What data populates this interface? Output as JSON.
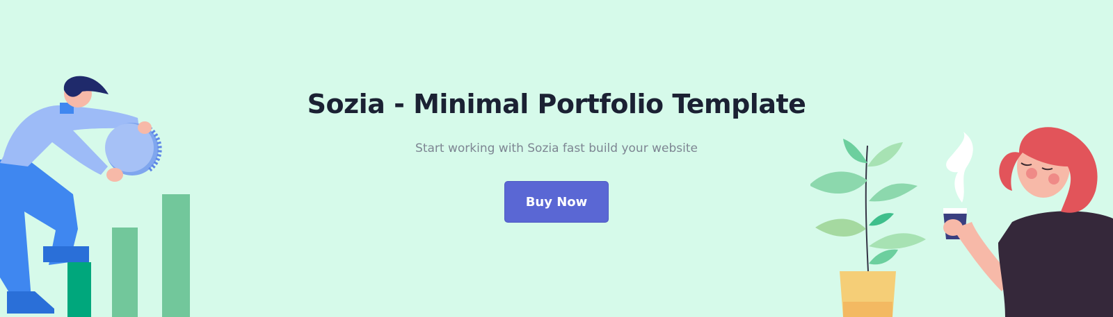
{
  "hero": {
    "title": "Sozia - Minimal Portfolio Template",
    "subtitle": "Start working with Sozia fast build your website",
    "button_label": "Buy Now"
  },
  "colors": {
    "background": "#d6faea",
    "accent": "#5a67d4",
    "title": "#1b2133",
    "subtitle": "#7d8592"
  },
  "illustrations": {
    "left": "person-stacking-coin-icon",
    "right_plant": "potted-plant-icon",
    "right_person": "woman-with-coffee-icon"
  }
}
